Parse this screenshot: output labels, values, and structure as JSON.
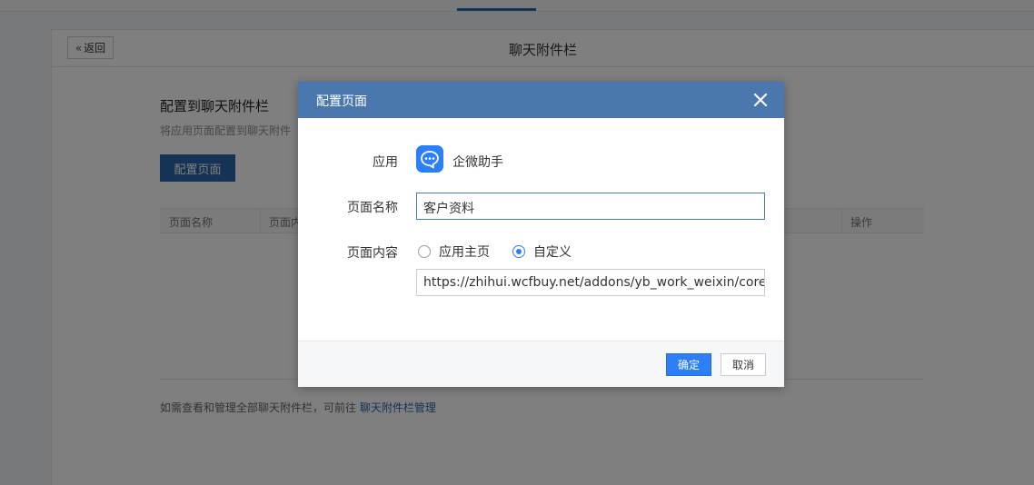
{
  "panel": {
    "back_label": "返回",
    "title": "聊天附件栏"
  },
  "section": {
    "title": "配置到聊天附件栏",
    "description": "将应用页面配置到聊天附件",
    "config_button": "配置页面"
  },
  "table": {
    "columns": [
      "页面名称",
      "页面内",
      "操作"
    ]
  },
  "footer": {
    "note": "如需查看和管理全部聊天附件栏，可前往",
    "link": "聊天附件栏管理"
  },
  "modal": {
    "title": "配置页面",
    "app_label": "应用",
    "app_name": "企微助手",
    "page_name_label": "页面名称",
    "page_name_value": "客户资料",
    "page_content_label": "页面内容",
    "radio_home": "应用主页",
    "radio_custom": "自定义",
    "selected_option": "自定义",
    "url_value": "https://zhihui.wcfbuy.net/addons/yb_work_weixin/core/",
    "ok_label": "确定",
    "cancel_label": "取消"
  },
  "colors": {
    "header_blue": "#4a78ae",
    "primary_blue": "#2d7ff9",
    "dark_blue": "#2b66a9"
  }
}
